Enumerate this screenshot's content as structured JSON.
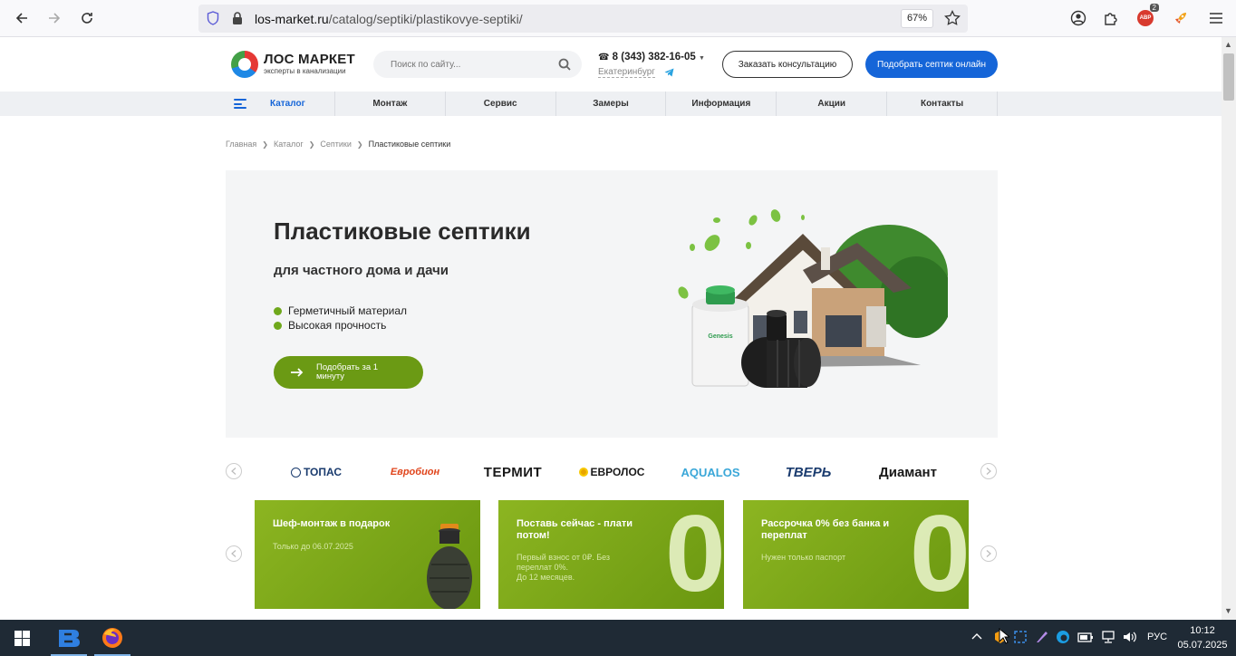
{
  "browser": {
    "url_domain": "los-market.ru",
    "url_path": "/catalog/septiki/plastikovye-septiki/",
    "zoom": "67%",
    "badge_count": "2",
    "badge_label": "ABP"
  },
  "header": {
    "logo_title": "ЛОС МАРКЕТ",
    "logo_tagline": "эксперты в канализации",
    "search_placeholder": "Поиск по сайту...",
    "phone": "8 (343) 382-16-05",
    "city": "Екатеринбург",
    "consult_button": "Заказать консультацию",
    "pick_button": "Подобрать септик онлайн"
  },
  "menu": [
    "Каталог",
    "Монтаж",
    "Сервис",
    "Замеры",
    "Информация",
    "Акции",
    "Контакты"
  ],
  "breadcrumbs": [
    "Главная",
    "Каталог",
    "Септики",
    "Пластиковые септики"
  ],
  "hero": {
    "title": "Пластиковые септики",
    "subtitle": "для частного дома и дачи",
    "features": [
      "Герметичный материал",
      "Высокая прочность"
    ],
    "cta_line1": "Подобрать за 1",
    "cta_line2": "минуту",
    "tank_label": "Genesis"
  },
  "brands": [
    {
      "name": "ТОПАС",
      "color": "#1a3b6e"
    },
    {
      "name": "Евробион",
      "color": "#e0441b"
    },
    {
      "name": "ТЕРМИТ",
      "color": "#1a1a1a"
    },
    {
      "name": "ЕВРОЛОС",
      "color": "#1a1a1a"
    },
    {
      "name": "AQUALOS",
      "color": "#3aa7d8"
    },
    {
      "name": "ТВЕРЬ",
      "color": "#1a3b6e"
    },
    {
      "name": "Диамант",
      "color": "#1a1a1a"
    }
  ],
  "promos": [
    {
      "title": "Шеф-монтаж в подарок",
      "text": "Только до 06.07.2025"
    },
    {
      "title": "Поставь сейчас - плати потом!",
      "text1": "Первый взнос от 0₽. Без переплат 0%.",
      "text2": "До 12 месяцев.",
      "big": "0"
    },
    {
      "title": "Рассрочка 0% без банка и переплат",
      "text": "Нужен только паспорт",
      "big": "0"
    }
  ],
  "taskbar": {
    "lang": "РУС",
    "time": "10:12",
    "date": "05.07.2025"
  },
  "colors": {
    "accent_blue": "#1565d8",
    "accent_green": "#6b9a14"
  }
}
